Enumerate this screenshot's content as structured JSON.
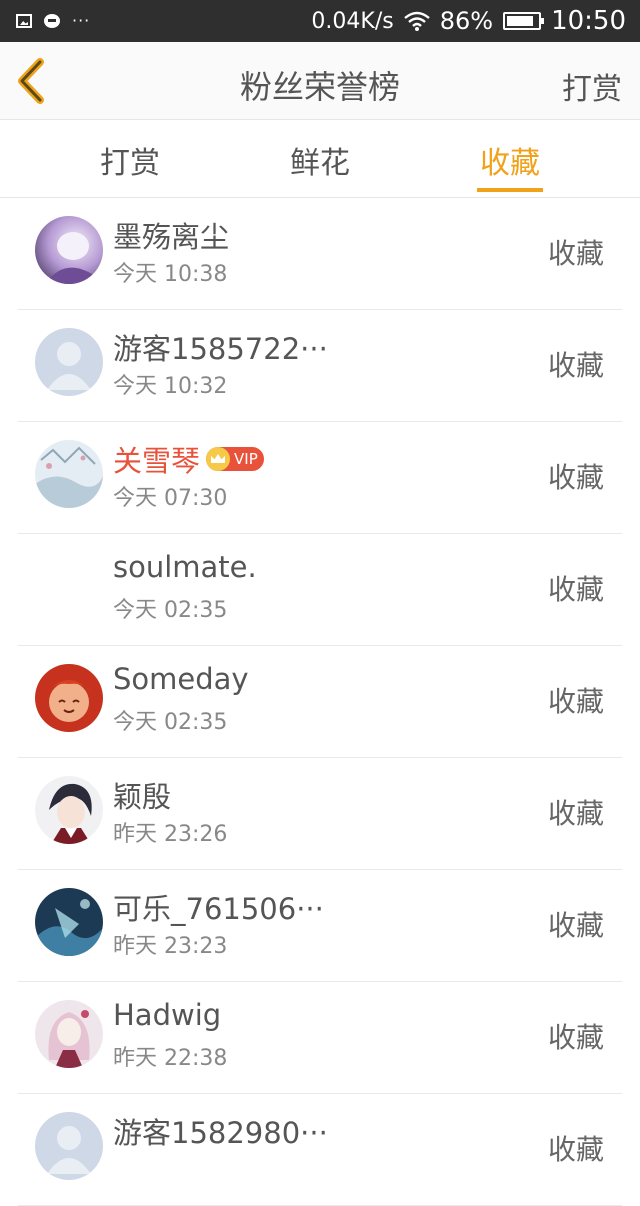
{
  "status_bar": {
    "net_speed": "0.04K/s",
    "battery": "86%",
    "battery_level": 0.86,
    "time": "10:50",
    "dots": "···"
  },
  "header": {
    "title": "粉丝荣誉榜",
    "action": "打赏"
  },
  "tabs": [
    {
      "label": "打赏",
      "active": false
    },
    {
      "label": "鲜花",
      "active": false
    },
    {
      "label": "收藏",
      "active": true
    }
  ],
  "colors": {
    "accent": "#f0a21a",
    "vip": "#e8513a"
  },
  "list": [
    {
      "name": "墨殇离尘",
      "time": "今天 10:38",
      "action": "收藏",
      "avatar": "anime-girl-purple"
    },
    {
      "name": "游客1585722···",
      "time": "今天 10:32",
      "action": "收藏",
      "avatar": "default-user"
    },
    {
      "name": "关雪琴",
      "time": "今天 07:30",
      "action": "收藏",
      "avatar": "snow-scene",
      "vip": true,
      "vip_label": "VIP"
    },
    {
      "name": "soulmate.",
      "time": "今天 02:35",
      "action": "收藏",
      "avatar": "none"
    },
    {
      "name": "Someday",
      "time": "今天 02:35",
      "action": "收藏",
      "avatar": "anime-red"
    },
    {
      "name": "颖殷",
      "time": "昨天 23:26",
      "action": "收藏",
      "avatar": "anime-boy-dark"
    },
    {
      "name": "可乐_761506···",
      "time": "昨天 23:23",
      "action": "收藏",
      "avatar": "anime-blue"
    },
    {
      "name": "Hadwig",
      "time": "昨天 22:38",
      "action": "收藏",
      "avatar": "anime-pink"
    },
    {
      "name": "游客1582980···",
      "time": "",
      "action": "收藏",
      "avatar": "default-user"
    }
  ]
}
